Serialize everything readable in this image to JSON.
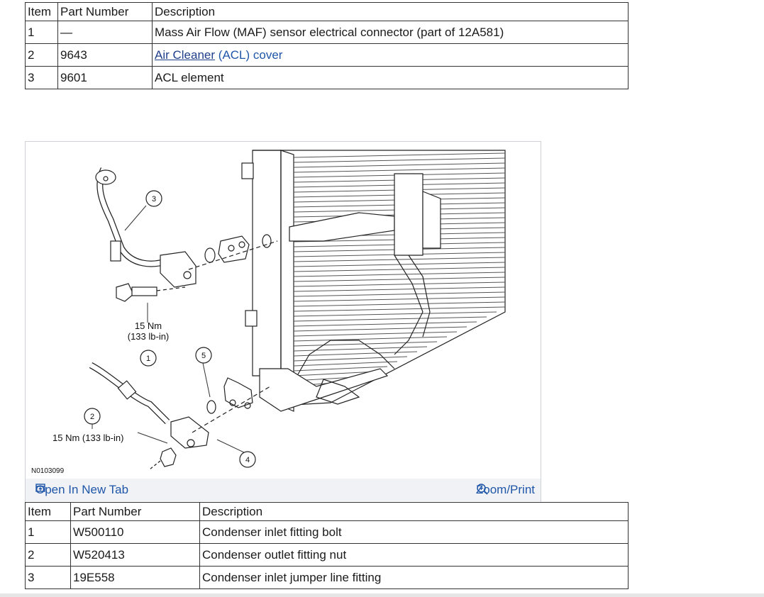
{
  "table1": {
    "headers": [
      "Item",
      "Part Number",
      "Description"
    ],
    "rows": [
      {
        "item": "1",
        "part": "—",
        "desc": "Mass Air Flow (MAF) sensor electrical connector (part of 12A581)"
      },
      {
        "item": "2",
        "part": "9643",
        "desc_link1": "Air Cleaner",
        "desc_link2": "(ACL) cover"
      },
      {
        "item": "3",
        "part": "9601",
        "desc": "ACL element"
      }
    ]
  },
  "figure": {
    "figure_id": "N0103099",
    "callouts": [
      "1",
      "2",
      "3",
      "4",
      "5"
    ],
    "torque_1_line1": "15 Nm",
    "torque_1_line2": "(133 lb-in)",
    "torque_2": "15 Nm (133 lb-in)",
    "open_tab_label": "Open In New Tab",
    "zoom_label": "Zoom/Print",
    "icons": [
      "open-tab-icon",
      "zoom-icon"
    ],
    "link_color": "#1f56a8"
  },
  "table2": {
    "headers": [
      "Item",
      "Part Number",
      "Description"
    ],
    "rows": [
      {
        "item": "1",
        "part": "W500110",
        "desc": "Condenser inlet fitting bolt"
      },
      {
        "item": "2",
        "part": "W520413",
        "desc": "Condenser outlet fitting nut"
      },
      {
        "item": "3",
        "part": "19E558",
        "desc": "Condenser inlet jumper line fitting"
      }
    ]
  }
}
